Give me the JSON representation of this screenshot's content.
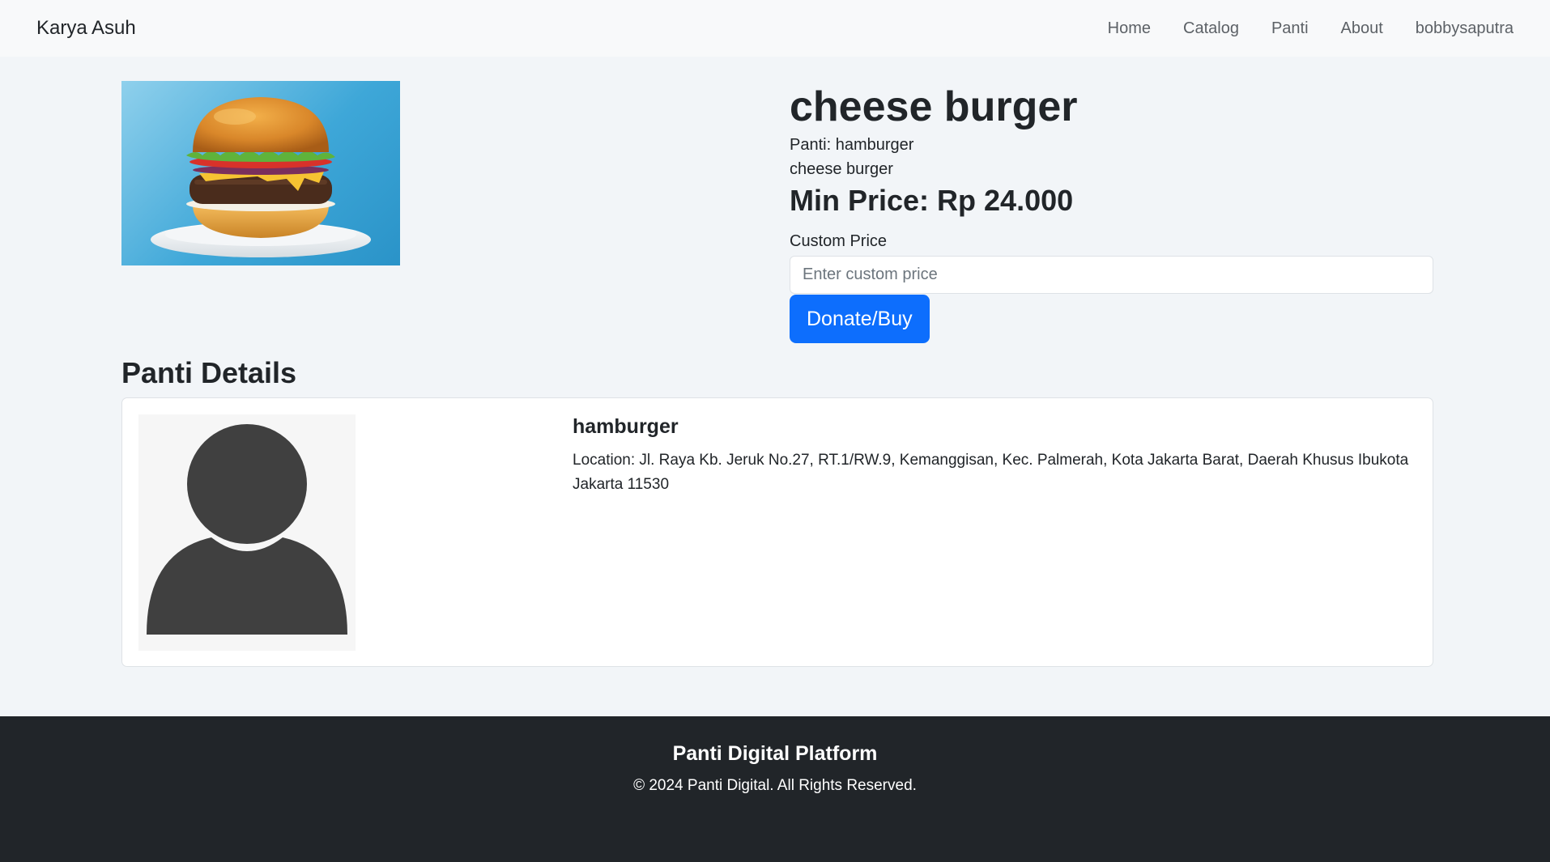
{
  "navbar": {
    "brand": "Karya Asuh",
    "links": [
      "Home",
      "Catalog",
      "Panti",
      "About",
      "bobbysaputra"
    ]
  },
  "product": {
    "image_alt": "cheese burger",
    "title": "cheese burger",
    "panti_line": "Panti: hamburger",
    "description": "cheese burger",
    "min_price": "Min Price: Rp 24.000",
    "custom_price_label": "Custom Price",
    "custom_price_value": "",
    "custom_price_placeholder": "Enter custom price",
    "buy_label": "Donate/Buy"
  },
  "panti_details": {
    "section_title": "Panti Details",
    "name": "hamburger",
    "location": "Location: Jl. Raya Kb. Jeruk No.27, RT.1/RW.9, Kemanggisan, Kec. Palmerah, Kota Jakarta Barat, Daerah Khusus Ibukota Jakarta 11530"
  },
  "footer": {
    "title": "Panti Digital Platform",
    "copyright": "© 2024 Panti Digital. All Rights Reserved."
  },
  "colors": {
    "primary": "#0d6efd",
    "navbar_bg": "#f8f9fa",
    "page_bg": "#f2f5f8",
    "footer_bg": "#212529"
  }
}
